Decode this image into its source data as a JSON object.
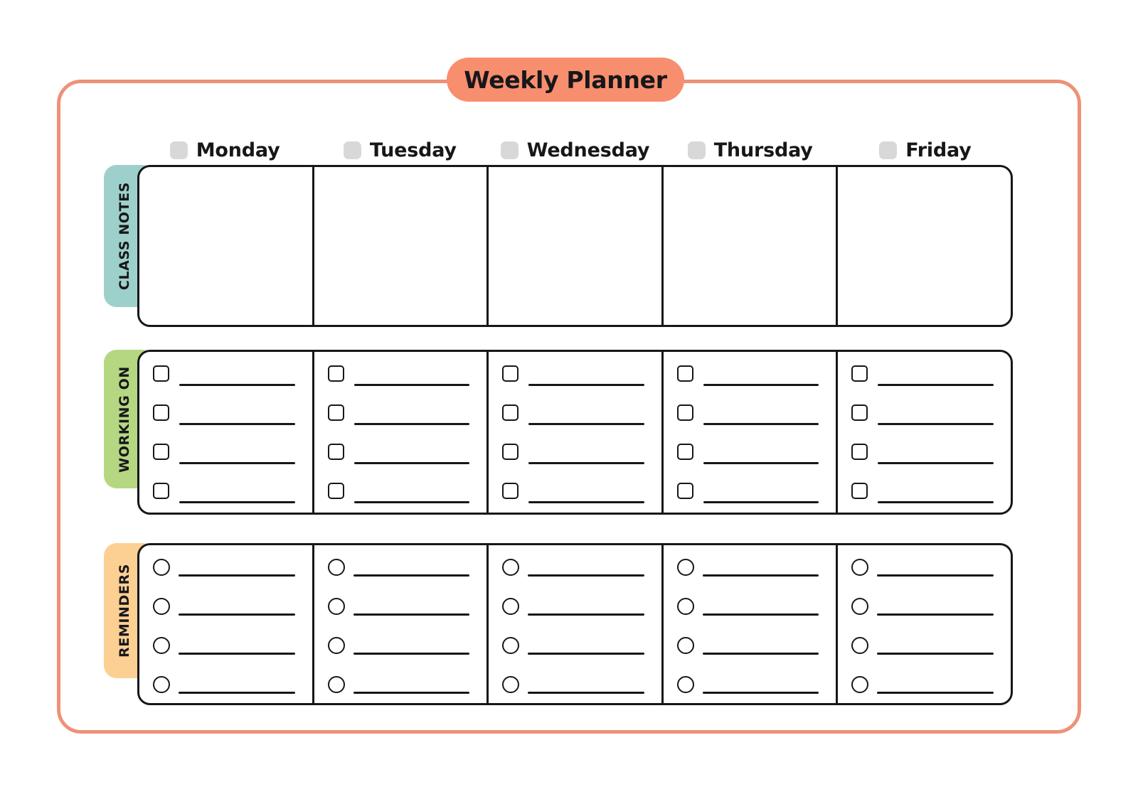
{
  "page": {
    "title": "Weekly Planner",
    "frame_color": "#EE9179",
    "title_pill_color": "#F78E6E"
  },
  "days": [
    {
      "label": "Monday",
      "chip_color": "#D8D8D8"
    },
    {
      "label": "Tuesday",
      "chip_color": "#D8D8D8"
    },
    {
      "label": "Wednesday",
      "chip_color": "#D8D8D8"
    },
    {
      "label": "Thursday",
      "chip_color": "#D8D8D8"
    },
    {
      "label": "Friday",
      "chip_color": "#D8D8D8"
    }
  ],
  "sections": [
    {
      "id": "class-notes",
      "label": "CLASS NOTES",
      "tab_color": "#9ED0CB",
      "row_type": "blank",
      "rows_per_day": 0
    },
    {
      "id": "working-on",
      "label": "WORKING ON",
      "tab_color": "#B5D782",
      "row_type": "checkbox",
      "rows_per_day": 4
    },
    {
      "id": "reminders",
      "label": "REMINDERS",
      "tab_color": "#FCCF92",
      "row_type": "circle",
      "rows_per_day": 4
    }
  ]
}
